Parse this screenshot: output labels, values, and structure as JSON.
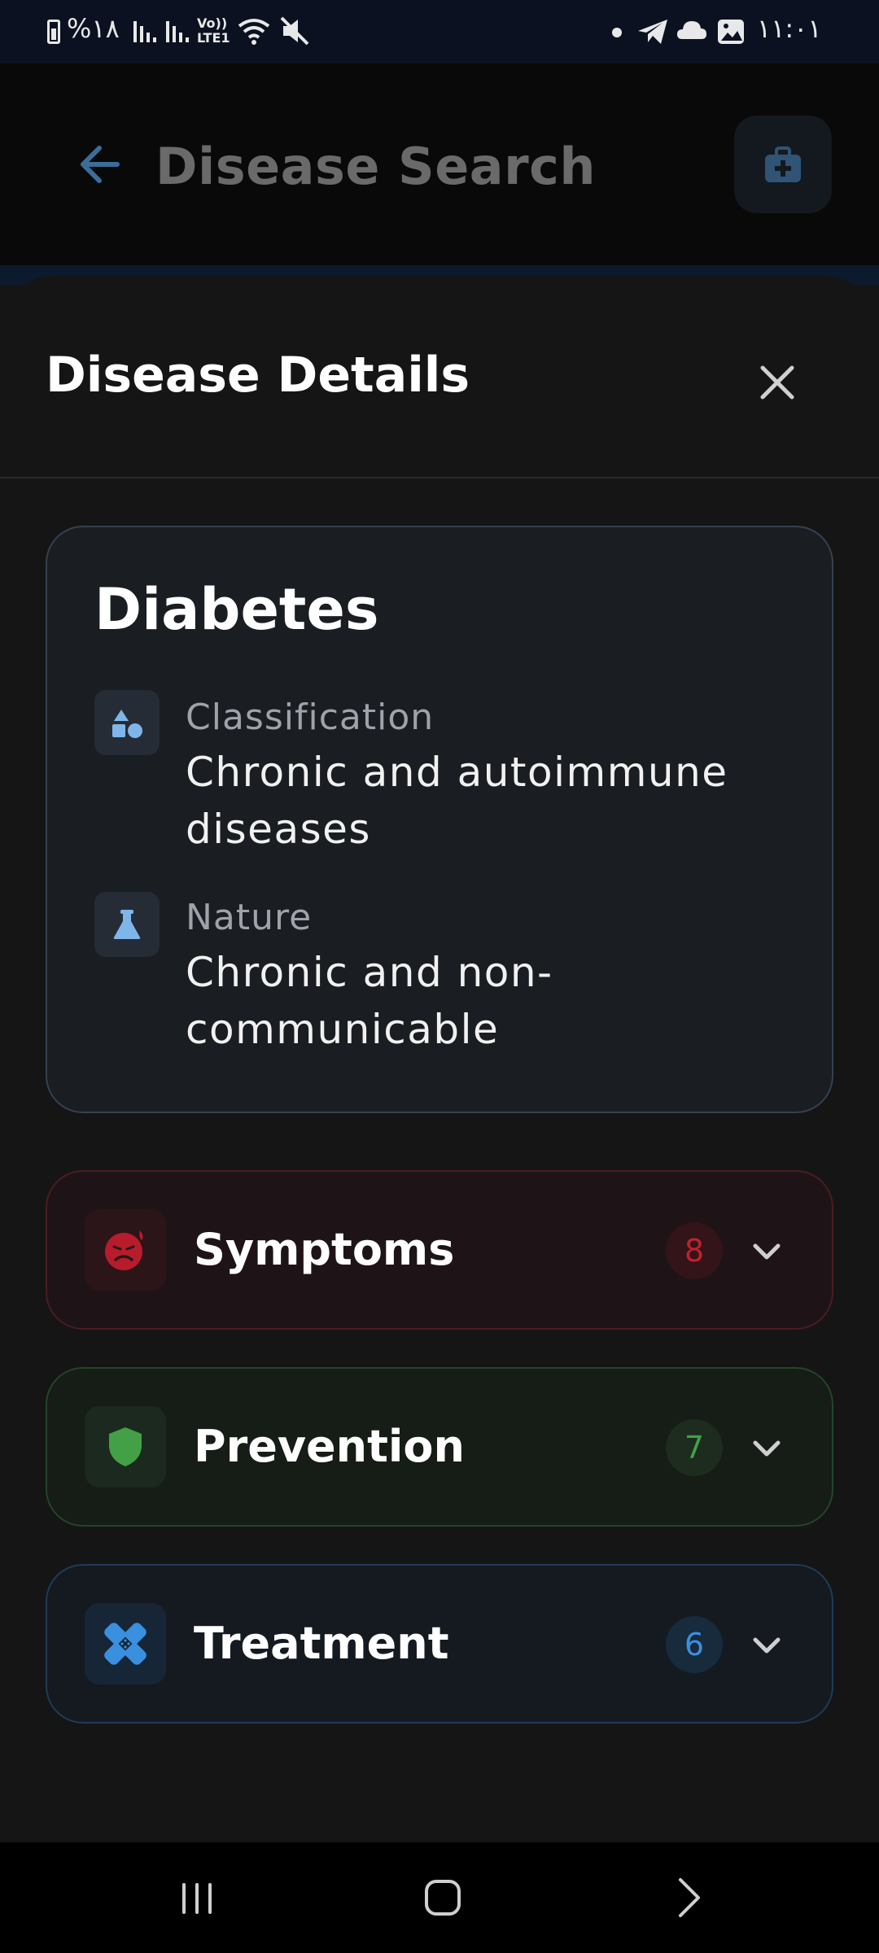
{
  "status_bar": {
    "left_text": "%١٨",
    "network_label": "Vo)) LTE1",
    "time": "١١:٠١"
  },
  "app_bar": {
    "title": "Disease Search",
    "back_icon": "arrow-left-icon",
    "action_icon": "medical-kit-icon"
  },
  "sheet": {
    "title": "Disease Details",
    "close_icon": "close-icon"
  },
  "disease": {
    "name": "Diabetes",
    "classification": {
      "label": "Classification",
      "value": "Chronic and autoimmune diseases",
      "icon": "shapes-icon"
    },
    "nature": {
      "label": "Nature",
      "value": "Chronic and non-communicable",
      "icon": "flask-icon"
    }
  },
  "sections": [
    {
      "label": "Symptoms",
      "count": "8",
      "icon": "sick-face-icon",
      "color": "#c1202e"
    },
    {
      "label": "Prevention",
      "count": "7",
      "icon": "shield-icon",
      "color": "#43a047"
    },
    {
      "label": "Treatment",
      "count": "6",
      "icon": "bandage-icon",
      "color": "#3b8fdf"
    }
  ],
  "nav_bar": {
    "recents_icon": "recent-apps-icon",
    "home_icon": "home-icon",
    "back_icon": "chevron-right-icon"
  }
}
